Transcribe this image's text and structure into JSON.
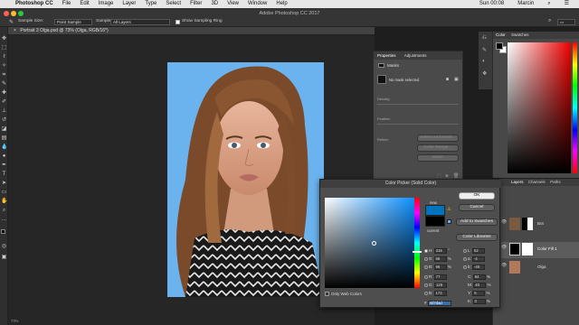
{
  "menubar": {
    "app_name": "Photoshop CC",
    "items": [
      "File",
      "Edit",
      "Image",
      "Layer",
      "Type",
      "Select",
      "Filter",
      "3D",
      "View",
      "Window",
      "Help"
    ],
    "clock": "Sun 00:08",
    "user": "Marcin"
  },
  "window": {
    "title": "Adobe Photoshop CC 2017"
  },
  "options_bar": {
    "sample_size_label": "Sample Size:",
    "sample_size_value": "Point Sample",
    "sample_label": "Sample:",
    "sample_value": "All Layers",
    "show_ring_label": "Show Sampling Ring"
  },
  "document_tab": {
    "label": "Portrait 3 Olga.psd @ 73% (Olga, RGB/16*)"
  },
  "properties_panel": {
    "tabs": [
      "Properties",
      "Adjustments"
    ],
    "section": "Masks",
    "mask_status": "No mask selected",
    "density_label": "Density:",
    "feather_label": "Feather:",
    "refine_label": "Refine:",
    "buttons": [
      "Select and Mask...",
      "Color Range...",
      "Invert"
    ]
  },
  "color_panel": {
    "tabs": [
      "Color",
      "Swatches"
    ]
  },
  "layers_panel": {
    "tabs": [
      "Layers",
      "Channels",
      "Paths"
    ],
    "layers": [
      {
        "name": "Bot"
      },
      {
        "name": "Color Fill 1"
      },
      {
        "name": "Olga"
      }
    ]
  },
  "color_picker": {
    "title": "Color Picker (Solid Color)",
    "new_label": "new",
    "current_label": "current",
    "ok_label": "OK",
    "cancel_label": "Cancel",
    "add_swatches_label": "Add to Swatches",
    "color_libraries_label": "Color Libraries",
    "only_web_colors_label": "Only Web Colors",
    "new_color": "#0073BF",
    "current_color": "#000000",
    "hsb": [
      {
        "label": "H:",
        "value": "215",
        "unit": "°"
      },
      {
        "label": "S:",
        "value": "56",
        "unit": "%"
      },
      {
        "label": "B:",
        "value": "96",
        "unit": "%"
      }
    ],
    "rgb": [
      {
        "label": "R:",
        "value": "77"
      },
      {
        "label": "G:",
        "value": "125"
      },
      {
        "label": "B:",
        "value": "173"
      }
    ],
    "lab": [
      {
        "label": "L:",
        "value": "52"
      },
      {
        "label": "a:",
        "value": "-4"
      },
      {
        "label": "b:",
        "value": "-45"
      }
    ],
    "cmyk": [
      {
        "label": "C:",
        "value": "84",
        "unit": "%"
      },
      {
        "label": "M:",
        "value": "40",
        "unit": "%"
      },
      {
        "label": "Y:",
        "value": "5",
        "unit": "%"
      },
      {
        "label": "K:",
        "value": "0",
        "unit": "%"
      }
    ],
    "hex_label": "#",
    "hex_value": "4d7dad"
  },
  "status_bar": {
    "zoom": "73%"
  },
  "colors": {
    "canvas_bg": "#6ab3ee",
    "accent": "#0a8fff"
  }
}
